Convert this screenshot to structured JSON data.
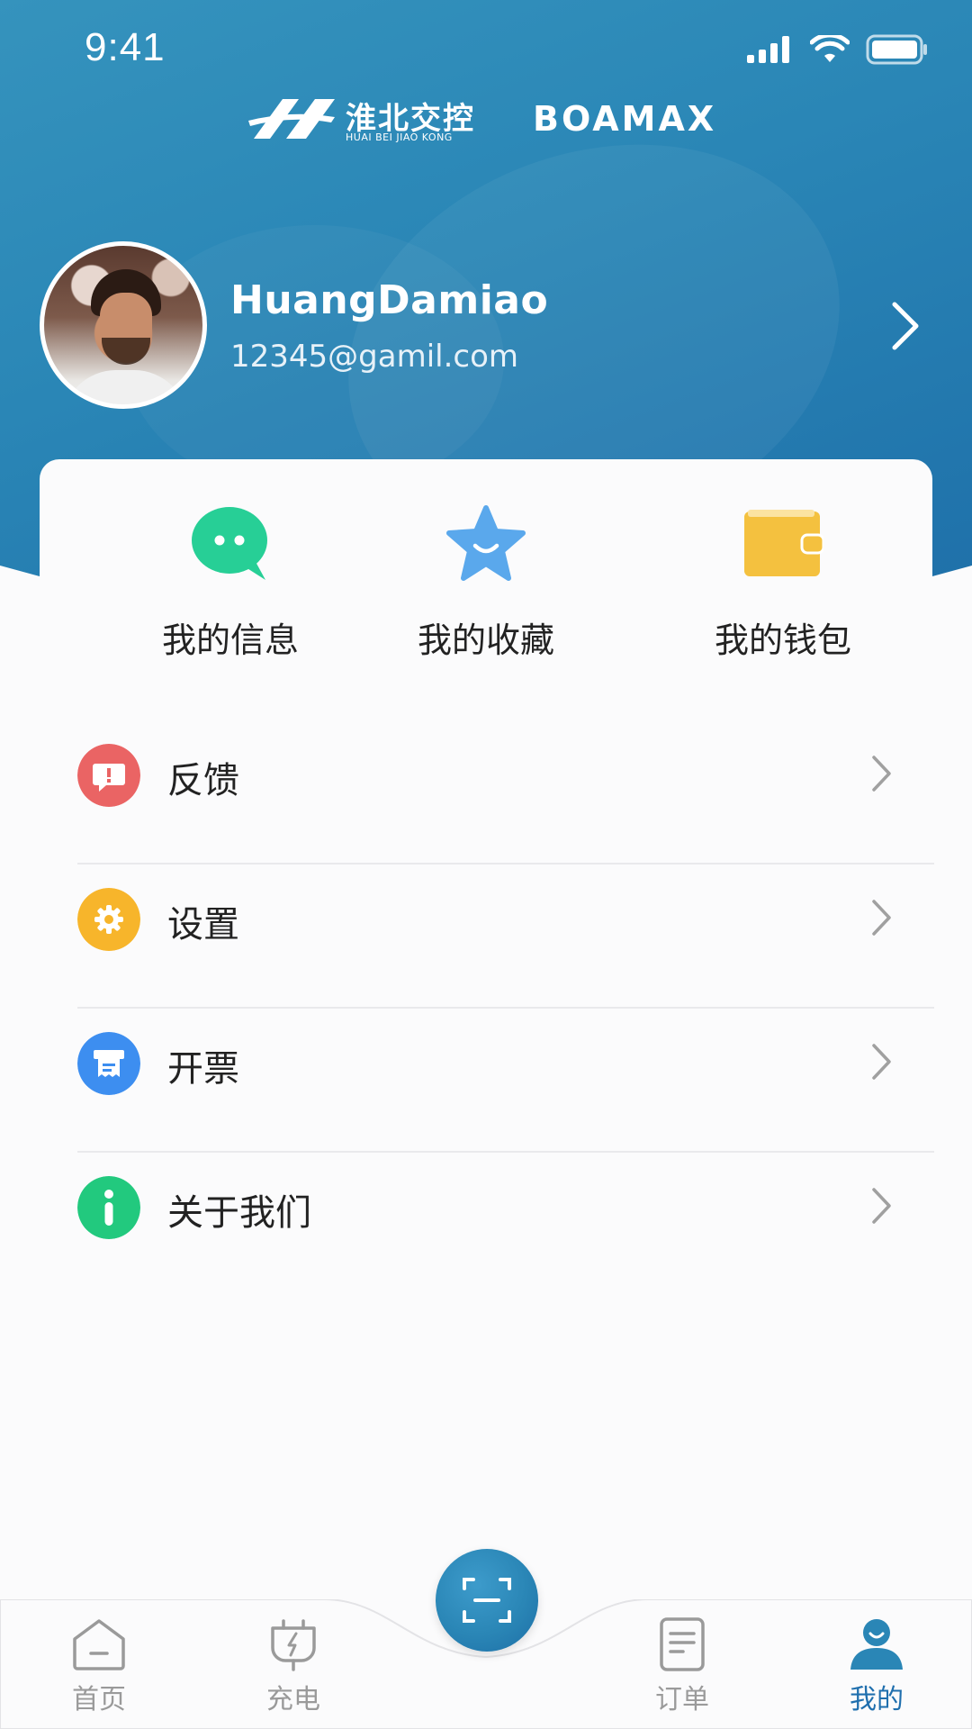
{
  "status_bar": {
    "time": "9:41"
  },
  "brand": {
    "cn_name": "淮北交控",
    "en_name": "HUAI BEI JIAO KONG",
    "partner": "BOAMAX"
  },
  "profile": {
    "name": "HuangDamiao",
    "email": "12345@gamil.com"
  },
  "quick_actions": [
    {
      "label": "我的信息",
      "icon": "message-bubble-icon",
      "color": "#27cf96"
    },
    {
      "label": "我的收藏",
      "icon": "star-icon",
      "color": "#5aa8ec"
    },
    {
      "label": "我的钱包",
      "icon": "wallet-icon",
      "color": "#f4c13f"
    }
  ],
  "menu": [
    {
      "label": "反馈",
      "icon": "feedback-icon",
      "color": "#ea6464"
    },
    {
      "label": "设置",
      "icon": "gear-icon",
      "color": "#f7b52b"
    },
    {
      "label": "开票",
      "icon": "invoice-icon",
      "color": "#3d8ef0"
    },
    {
      "label": "关于我们",
      "icon": "info-icon",
      "color": "#22c97e"
    }
  ],
  "tabbar": {
    "items": [
      {
        "label": "首页",
        "icon": "home-icon",
        "active": false
      },
      {
        "label": "充电",
        "icon": "charge-icon",
        "active": false
      },
      {
        "label": "订单",
        "icon": "order-icon",
        "active": false
      },
      {
        "label": "我的",
        "icon": "user-icon",
        "active": true
      }
    ],
    "center": {
      "icon": "scan-icon"
    },
    "active_color": "#1f6fae",
    "inactive_color": "#9a9a9a"
  }
}
